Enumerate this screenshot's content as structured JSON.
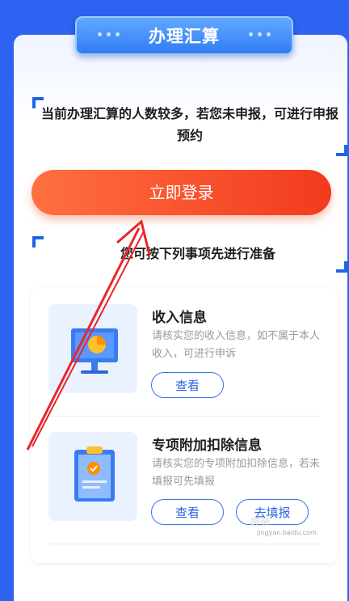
{
  "header": {
    "title": "办理汇算"
  },
  "notice": "当前办理汇算的人数较多，若您未申报，可进行申报预约",
  "login_button": "立即登录",
  "prep_text": "您可按下列事项先进行准备",
  "items": [
    {
      "title": "收入信息",
      "desc": "请核实您的收入信息，如不属于本人收入，可进行申诉",
      "view": "查看"
    },
    {
      "title": "专项附加扣除信息",
      "desc": "请核实您的专项附加扣除信息，若未填报可先填报",
      "view": "查看",
      "fill": "去填报"
    }
  ],
  "watermark": "经验",
  "watermark_sub": "jingyan.baidu.com",
  "colors": {
    "bg": "#2d63f0",
    "accent": "#3575ea",
    "cta": "#f23a1e"
  }
}
